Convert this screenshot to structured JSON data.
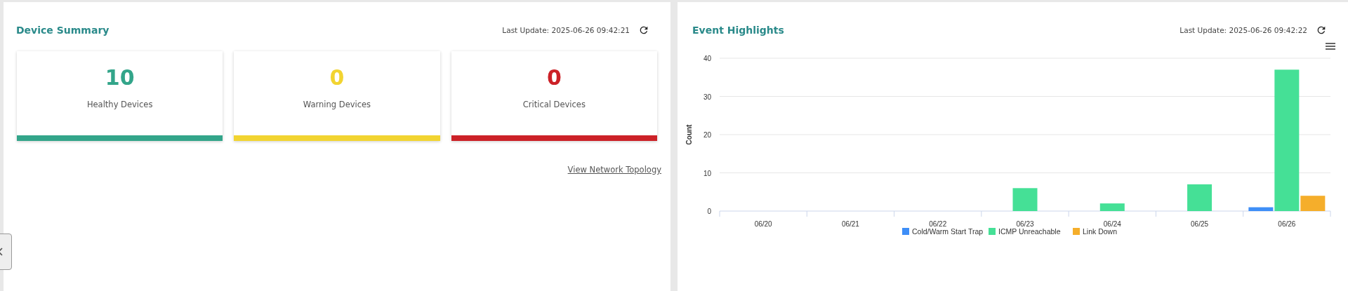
{
  "device_summary": {
    "title": "Device Summary",
    "last_update": "Last Update: 2025-06-26 09:42:21",
    "cards": [
      {
        "value": "10",
        "label": "Healthy Devices",
        "color": "#33a58a"
      },
      {
        "value": "0",
        "label": "Warning Devices",
        "color": "#f2d431"
      },
      {
        "value": "0",
        "label": "Critical Devices",
        "color": "#cc2127"
      }
    ],
    "link": "View Network Topology"
  },
  "event_highlights": {
    "title": "Event Highlights",
    "last_update": "Last Update: 2025-06-26 09:42:22",
    "chart_data": {
      "type": "bar",
      "ylabel": "Count",
      "categories": [
        "06/20",
        "06/21",
        "06/22",
        "06/23",
        "06/24",
        "06/25",
        "06/26"
      ],
      "ylim": [
        0,
        40
      ],
      "grid": true,
      "legend": "bottom",
      "yticks": [
        0,
        10,
        20,
        30,
        40
      ],
      "series": [
        {
          "name": "Cold/Warm Start Trap",
          "color": "#3e8ef7",
          "values": [
            0,
            0,
            0,
            0,
            0,
            0,
            1
          ]
        },
        {
          "name": "ICMP Unreachable",
          "color": "#45e096",
          "values": [
            0,
            0,
            0,
            6,
            2,
            7,
            37
          ]
        },
        {
          "name": "Link Down",
          "color": "#f5ae2b",
          "values": [
            0,
            0,
            0,
            0,
            0,
            0,
            4
          ]
        }
      ]
    }
  }
}
